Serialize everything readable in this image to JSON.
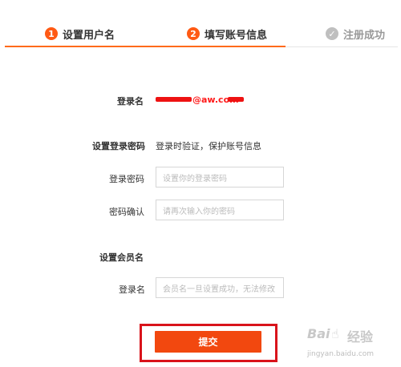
{
  "steps": [
    {
      "num": "1",
      "label": "设置用户名"
    },
    {
      "num": "2",
      "label": "填写账号信息"
    },
    {
      "num": "✓",
      "label": "注册成功"
    }
  ],
  "form": {
    "login_name_label": "登录名",
    "login_name_value": "@aw.com",
    "password_section_title": "设置登录密码",
    "password_section_hint": "登录时验证，保护账号信息",
    "password_label": "登录密码",
    "password_placeholder": "设置你的登录密码",
    "confirm_label": "密码确认",
    "confirm_placeholder": "请再次输入你的密码",
    "member_section_title": "设置会员名",
    "member_label": "登录名",
    "member_placeholder": "会员名一旦设置成功，无法修改"
  },
  "submit_label": "提交",
  "watermark": {
    "brand": "Bai",
    "paw": "☝",
    "tail": "经验",
    "url": "jingyan.baidu.com"
  },
  "colors": {
    "accent": "#ff5a14",
    "button": "#f2480f",
    "highlight_box": "#d9131b"
  }
}
